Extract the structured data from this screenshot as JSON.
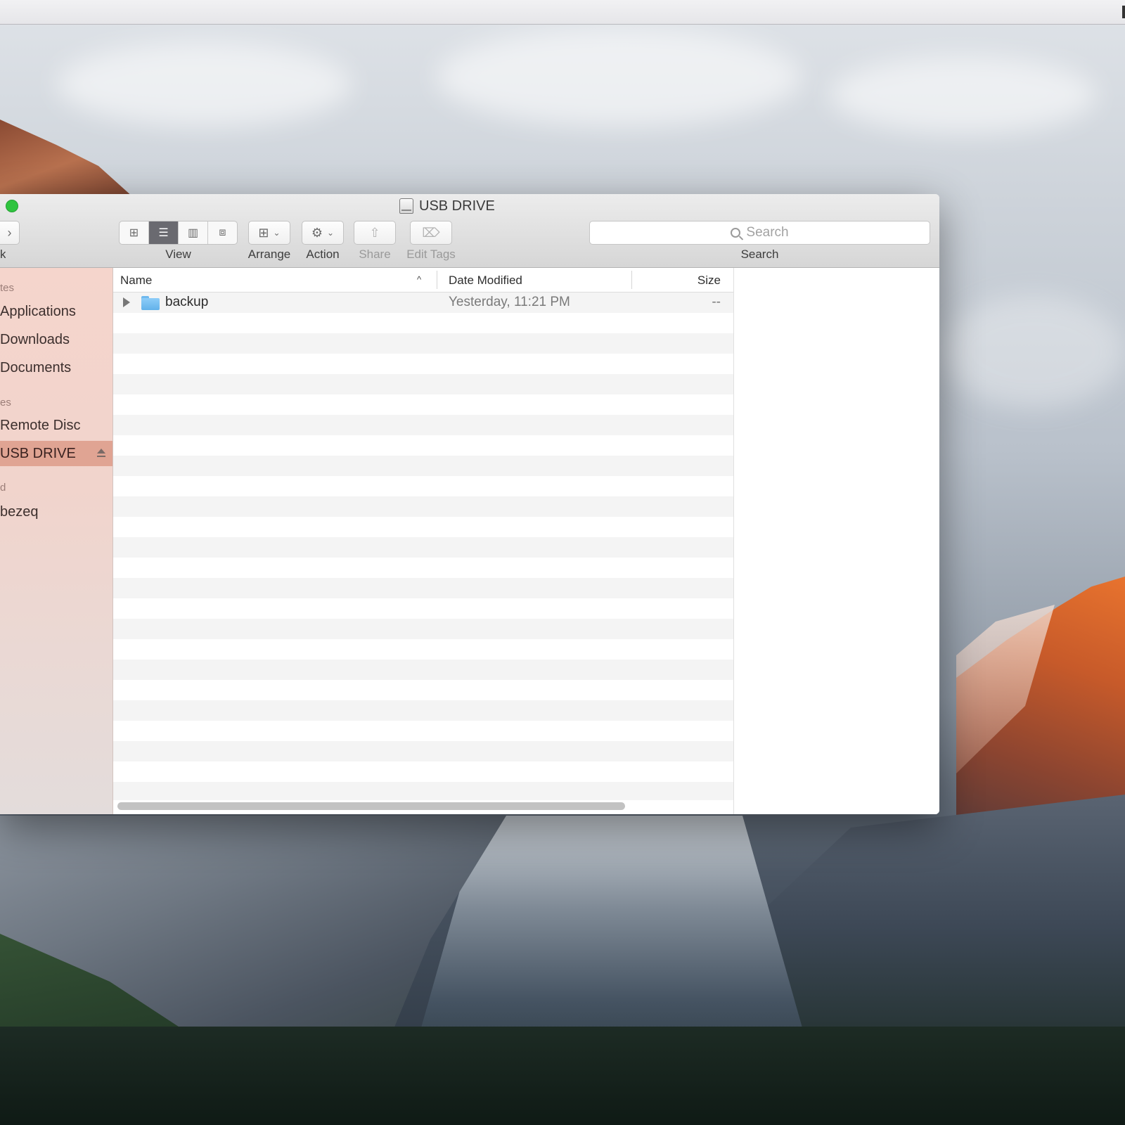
{
  "window": {
    "title": "USB DRIVE"
  },
  "toolbar": {
    "back_label": "k",
    "view_label": "View",
    "arrange_label": "Arrange",
    "action_label": "Action",
    "share_label": "Share",
    "edit_tags_label": "Edit Tags",
    "search_label": "Search",
    "search_placeholder": "Search",
    "active_view": "list"
  },
  "sidebar": {
    "sections": [
      {
        "heading": "tes",
        "items": [
          "Applications",
          "Downloads",
          "Documents"
        ]
      },
      {
        "heading": "es",
        "items": [
          "Remote Disc",
          "USB DRIVE"
        ]
      },
      {
        "heading": "d",
        "items": [
          "bezeq"
        ]
      }
    ],
    "selected_item": "USB DRIVE",
    "accent_color": "#e0a493"
  },
  "list": {
    "columns": {
      "name": "Name",
      "date": "Date Modified",
      "size": "Size"
    },
    "sort_indicator": "^",
    "rows": [
      {
        "name": "backup",
        "date_modified": "Yesterday, 11:21 PM",
        "size": "--",
        "kind": "folder"
      }
    ]
  }
}
